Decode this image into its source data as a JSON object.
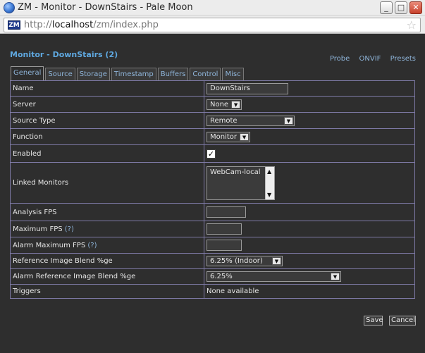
{
  "window": {
    "title": "ZM - Monitor - DownStairs - Pale Moon",
    "minimize": "_",
    "maximize": "□",
    "close": "✕"
  },
  "urlbar": {
    "favicon": "ZM",
    "prefix": "http://",
    "host": "localhost",
    "path": "/zm/index.php",
    "bookmark_icon": "☆"
  },
  "page": {
    "title": "Monitor - DownStairs (2)",
    "links": [
      "Probe",
      "ONVIF",
      "Presets"
    ],
    "tabs": [
      "General",
      "Source",
      "Storage",
      "Timestamp",
      "Buffers",
      "Control",
      "Misc"
    ],
    "active_tab": "General"
  },
  "form": {
    "name": {
      "label": "Name",
      "value": "DownStairs"
    },
    "server": {
      "label": "Server",
      "value": "None"
    },
    "source_type": {
      "label": "Source Type",
      "value": "Remote"
    },
    "function": {
      "label": "Function",
      "value": "Monitor"
    },
    "enabled": {
      "label": "Enabled",
      "checked": true
    },
    "linked_monitors": {
      "label": "Linked Monitors",
      "options": [
        "WebCam-local"
      ]
    },
    "analysis_fps": {
      "label": "Analysis FPS",
      "value": ""
    },
    "max_fps": {
      "label": "Maximum FPS",
      "help": "(?)",
      "value": ""
    },
    "alarm_max_fps": {
      "label": "Alarm Maximum FPS",
      "help": "(?)",
      "value": ""
    },
    "ref_blend": {
      "label": "Reference Image Blend %ge",
      "value": "6.25% (Indoor)"
    },
    "alarm_ref_blend": {
      "label": "Alarm Reference Image Blend %ge",
      "value": "6.25%"
    },
    "triggers": {
      "label": "Triggers",
      "value": "None available"
    }
  },
  "buttons": {
    "save": "Save",
    "cancel": "Cancel"
  }
}
